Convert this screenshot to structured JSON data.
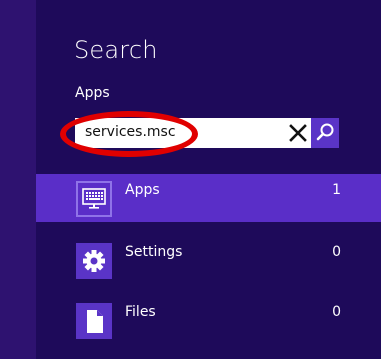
{
  "header": {
    "title": "Search",
    "scope": "Apps"
  },
  "search": {
    "value": "services.msc",
    "clear_icon": "close-icon",
    "search_icon": "magnifier-icon"
  },
  "results": [
    {
      "label": "Apps",
      "count": "1",
      "icon": "keyboard-display-icon",
      "selected": true
    },
    {
      "label": "Settings",
      "count": "0",
      "icon": "gear-icon",
      "selected": false
    },
    {
      "label": "Files",
      "count": "0",
      "icon": "document-icon",
      "selected": false
    }
  ],
  "colors": {
    "background": "#2a0f6b",
    "panel": "#1e0a5a",
    "accent": "#5a34c7",
    "selected": "#5a2ec8",
    "annotation": "#e00000"
  }
}
